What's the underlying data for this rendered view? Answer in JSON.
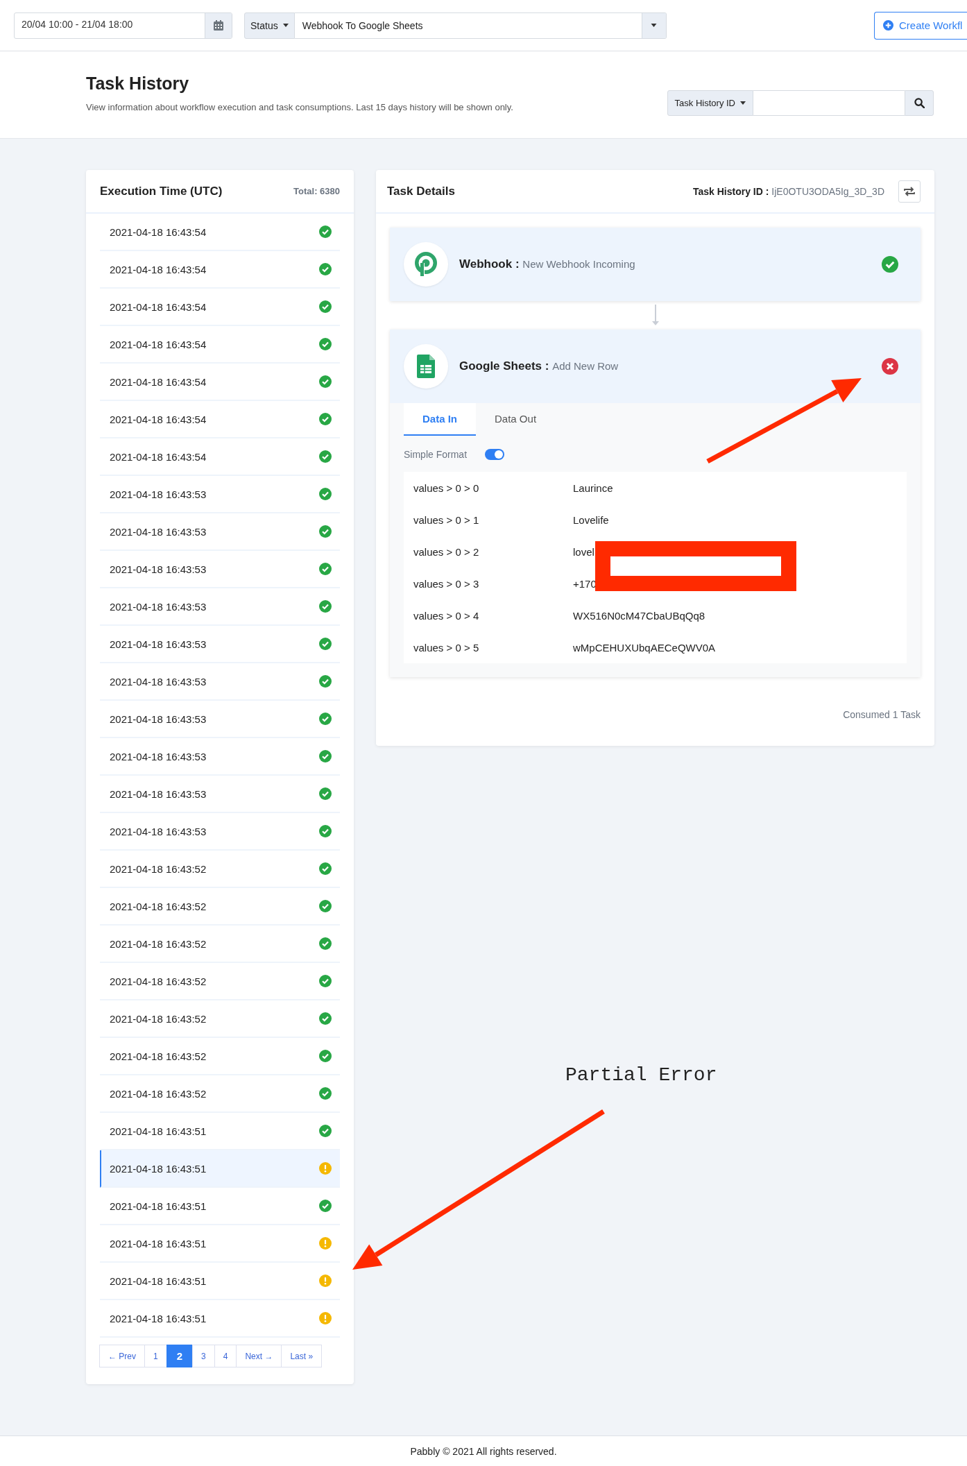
{
  "top_bar": {
    "date_range": "20/04 10:00 - 21/04 18:00",
    "status_filter": "Status",
    "workflow": "Webhook To Google Sheets",
    "create_button": "Create Workfl"
  },
  "header": {
    "title": "Task History",
    "subtitle": "View information about workflow execution and task consumptions. Last 15 days history will be shown only.",
    "search_type": "Task History ID"
  },
  "executions": {
    "title": "Execution Time (UTC)",
    "total": "Total: 6380",
    "rows": [
      {
        "time": "2021-04-18 16:43:54",
        "kind": "success",
        "selected": false
      },
      {
        "time": "2021-04-18 16:43:54",
        "kind": "success",
        "selected": false
      },
      {
        "time": "2021-04-18 16:43:54",
        "kind": "success",
        "selected": false
      },
      {
        "time": "2021-04-18 16:43:54",
        "kind": "success",
        "selected": false
      },
      {
        "time": "2021-04-18 16:43:54",
        "kind": "success",
        "selected": false
      },
      {
        "time": "2021-04-18 16:43:54",
        "kind": "success",
        "selected": false
      },
      {
        "time": "2021-04-18 16:43:54",
        "kind": "success",
        "selected": false
      },
      {
        "time": "2021-04-18 16:43:53",
        "kind": "success",
        "selected": false
      },
      {
        "time": "2021-04-18 16:43:53",
        "kind": "success",
        "selected": false
      },
      {
        "time": "2021-04-18 16:43:53",
        "kind": "success",
        "selected": false
      },
      {
        "time": "2021-04-18 16:43:53",
        "kind": "success",
        "selected": false
      },
      {
        "time": "2021-04-18 16:43:53",
        "kind": "success",
        "selected": false
      },
      {
        "time": "2021-04-18 16:43:53",
        "kind": "success",
        "selected": false
      },
      {
        "time": "2021-04-18 16:43:53",
        "kind": "success",
        "selected": false
      },
      {
        "time": "2021-04-18 16:43:53",
        "kind": "success",
        "selected": false
      },
      {
        "time": "2021-04-18 16:43:53",
        "kind": "success",
        "selected": false
      },
      {
        "time": "2021-04-18 16:43:53",
        "kind": "success",
        "selected": false
      },
      {
        "time": "2021-04-18 16:43:52",
        "kind": "success",
        "selected": false
      },
      {
        "time": "2021-04-18 16:43:52",
        "kind": "success",
        "selected": false
      },
      {
        "time": "2021-04-18 16:43:52",
        "kind": "success",
        "selected": false
      },
      {
        "time": "2021-04-18 16:43:52",
        "kind": "success",
        "selected": false
      },
      {
        "time": "2021-04-18 16:43:52",
        "kind": "success",
        "selected": false
      },
      {
        "time": "2021-04-18 16:43:52",
        "kind": "success",
        "selected": false
      },
      {
        "time": "2021-04-18 16:43:52",
        "kind": "success",
        "selected": false
      },
      {
        "time": "2021-04-18 16:43:51",
        "kind": "success",
        "selected": false
      },
      {
        "time": "2021-04-18 16:43:51",
        "kind": "warning",
        "selected": true
      },
      {
        "time": "2021-04-18 16:43:51",
        "kind": "success",
        "selected": false
      },
      {
        "time": "2021-04-18 16:43:51",
        "kind": "warning",
        "selected": false
      },
      {
        "time": "2021-04-18 16:43:51",
        "kind": "warning",
        "selected": false
      },
      {
        "time": "2021-04-18 16:43:51",
        "kind": "warning",
        "selected": false
      }
    ],
    "pagination": [
      {
        "label": "← Prev",
        "selected": false
      },
      {
        "label": "1",
        "selected": false
      },
      {
        "label": "2",
        "selected": true
      },
      {
        "label": "3",
        "selected": false
      },
      {
        "label": "4",
        "selected": false
      },
      {
        "label": "Next →",
        "selected": false
      },
      {
        "label": "Last »",
        "selected": false
      }
    ]
  },
  "details": {
    "title": "Task Details",
    "id_label": "Task History ID :",
    "id_value": "IjE0OTU3ODA5Ig_3D_3D",
    "steps": [
      {
        "app": "Webhook :",
        "action": "New Webhook Incoming",
        "failed": false,
        "expanded": false
      },
      {
        "app": "Google Sheets :",
        "action": "Add New Row",
        "failed": true,
        "expanded": true
      }
    ],
    "tabs": [
      {
        "label": "Data In",
        "selected": true
      },
      {
        "label": "Data Out",
        "selected": false
      }
    ],
    "simple_format": {
      "label": "Simple Format",
      "on": true
    },
    "data": [
      {
        "key": "values > 0 > 0",
        "value": "Laurince"
      },
      {
        "key": "values > 0 > 1",
        "value": "Lovelife"
      },
      {
        "key": "values > 0 > 2",
        "value": "lovel"
      },
      {
        "key": "values > 0 > 3",
        "value": "+170"
      },
      {
        "key": "values > 0 > 4",
        "value": "WX516N0cM47CbaUBqQq8"
      },
      {
        "key": "values > 0 > 5",
        "value": "wMpCEHUXUbqAECeQWV0A"
      }
    ],
    "consumed": "Consumed 1 Task"
  },
  "annotation": {
    "text": "Partial Error"
  },
  "footer": "Pabbly © 2021 All rights reserved."
}
